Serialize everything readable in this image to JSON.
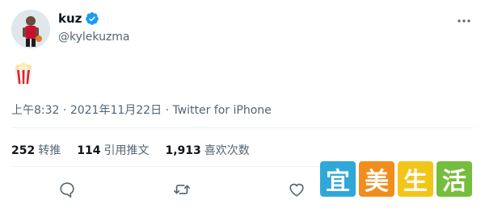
{
  "author": {
    "display_name": "kuz",
    "handle": "@kylekuzma",
    "verified": true
  },
  "tweet": {
    "body_emoji": "popcorn-emoji"
  },
  "meta": {
    "time": "上午8:32",
    "separator": " · ",
    "date": "2021年11月22日",
    "source": "Twitter for iPhone"
  },
  "stats": [
    {
      "count": "252",
      "label": "转推"
    },
    {
      "count": "114",
      "label": "引用推文"
    },
    {
      "count": "1,913",
      "label": "喜欢次数"
    }
  ],
  "watermark": [
    "宜",
    "美",
    "生",
    "活"
  ],
  "colors": {
    "verified": "#1d9bf0",
    "muted_text": "#536471",
    "text": "#0f1419",
    "divider": "#eff3f4"
  }
}
